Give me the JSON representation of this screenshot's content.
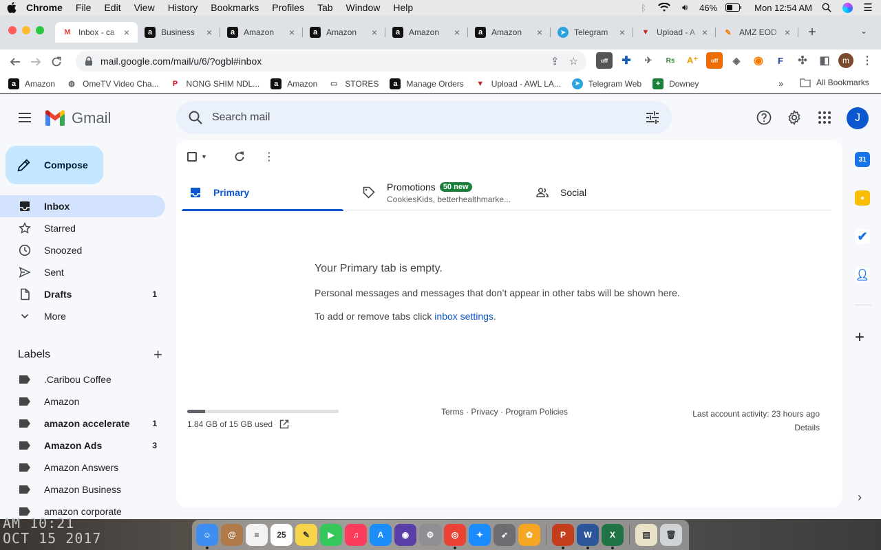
{
  "menubar": {
    "app": "Chrome",
    "items": [
      "File",
      "Edit",
      "View",
      "History",
      "Bookmarks",
      "Profiles",
      "Tab",
      "Window",
      "Help"
    ],
    "battery": "46%",
    "clock": "Mon 12:54 AM"
  },
  "tabs": [
    {
      "label": "Inbox - ca",
      "favicon": "gmail-icon",
      "color": "#ea4335"
    },
    {
      "label": "Business",
      "favicon": "amazon-icon",
      "color": "#111111"
    },
    {
      "label": "Amazon",
      "favicon": "amazon-icon",
      "color": "#111111"
    },
    {
      "label": "Amazon",
      "favicon": "amazon-icon",
      "color": "#111111"
    },
    {
      "label": "Amazon",
      "favicon": "amazon-icon",
      "color": "#111111"
    },
    {
      "label": "Amazon",
      "favicon": "amazon-icon",
      "color": "#111111"
    },
    {
      "label": "Telegram",
      "favicon": "telegram-icon",
      "color": "#2aa3df"
    },
    {
      "label": "Upload - A",
      "favicon": "upload-icon",
      "color": "#c62828"
    },
    {
      "label": "AMZ EOD",
      "favicon": "pencil-icon",
      "color": "#f57c00"
    }
  ],
  "omnibox": {
    "url": "mail.google.com/mail/u/6/?ogbl#inbox"
  },
  "bookmarks": [
    {
      "label": "Amazon",
      "icon": "amazon-icon",
      "color": "#111111",
      "glyph": "a"
    },
    {
      "label": "OmeTV Video Cha...",
      "icon": "globe-icon",
      "color": "#5f6368",
      "glyph": "◍"
    },
    {
      "label": "NONG SHIM NDL...",
      "icon": "pinterest-icon",
      "color": "#e60023",
      "glyph": "P"
    },
    {
      "label": "Amazon",
      "icon": "amazon-icon",
      "color": "#111111",
      "glyph": "a"
    },
    {
      "label": "STORES",
      "icon": "folder-icon",
      "color": "#5f6368",
      "glyph": "▭"
    },
    {
      "label": "Manage Orders",
      "icon": "amazon-icon",
      "color": "#111111",
      "glyph": "a"
    },
    {
      "label": "Upload - AWL LA...",
      "icon": "upload-icon",
      "color": "#c62828",
      "glyph": "▼"
    },
    {
      "label": "Telegram Web",
      "icon": "telegram-icon",
      "color": "#2aa3df",
      "glyph": "➤"
    },
    {
      "label": "Downey",
      "icon": "sheets-icon",
      "color": "#188038",
      "glyph": "+"
    }
  ],
  "all_bookmarks": "All Bookmarks",
  "gmail": {
    "logo_text": "Gmail",
    "search_placeholder": "Search mail",
    "avatar_letter": "J",
    "compose": "Compose",
    "nav": [
      {
        "label": "Inbox",
        "count": "",
        "icon": "inbox-icon",
        "active": true,
        "bold": true
      },
      {
        "label": "Starred",
        "count": "",
        "icon": "star-icon",
        "active": false,
        "bold": false
      },
      {
        "label": "Snoozed",
        "count": "",
        "icon": "clock-icon",
        "active": false,
        "bold": false
      },
      {
        "label": "Sent",
        "count": "",
        "icon": "send-icon",
        "active": false,
        "bold": false
      },
      {
        "label": "Drafts",
        "count": "1",
        "icon": "draft-icon",
        "active": false,
        "bold": true
      },
      {
        "label": "More",
        "count": "",
        "icon": "chevron-down-icon",
        "active": false,
        "bold": false
      }
    ],
    "labels_title": "Labels",
    "labels": [
      {
        "label": ".Caribou Coffee",
        "count": "",
        "bold": false
      },
      {
        "label": "Amazon",
        "count": "",
        "bold": false
      },
      {
        "label": "amazon accelerate",
        "count": "1",
        "bold": true
      },
      {
        "label": "Amazon Ads",
        "count": "3",
        "bold": true
      },
      {
        "label": "Amazon Answers",
        "count": "",
        "bold": false
      },
      {
        "label": "Amazon Business",
        "count": "",
        "bold": false
      },
      {
        "label": "amazon corporate",
        "count": "",
        "bold": false
      }
    ],
    "tabs": {
      "primary": "Primary",
      "promotions": "Promotions",
      "promotions_badge": "50 new",
      "promotions_sub": "CookiesKids, betterhealthmarke...",
      "social": "Social"
    },
    "empty": {
      "title": "Your Primary tab is empty.",
      "line1": "Personal messages and messages that don’t appear in other tabs will be shown here.",
      "line2_prefix": "To add or remove tabs click ",
      "line2_link": "inbox settings",
      "line2_suffix": "."
    },
    "storage": {
      "text": "1.84 GB of 15 GB used",
      "fraction": 0.12
    },
    "footer": {
      "links": "Terms · Privacy · Program Policies",
      "activity": "Last account activity: 23 hours ago",
      "details": "Details"
    }
  },
  "desktop_clock": {
    "line1": "AM 10:21",
    "line2": "OCT 15 2017"
  },
  "dock": [
    {
      "name": "finder",
      "color": "#3d8ef0",
      "glyph": "☺",
      "run": true
    },
    {
      "name": "contacts",
      "color": "#b07a4a",
      "glyph": "@",
      "run": false
    },
    {
      "name": "reminders",
      "color": "#f2f2f2",
      "glyph": "≡",
      "run": false
    },
    {
      "name": "calendar",
      "color": "#ffffff",
      "glyph": "25",
      "run": false
    },
    {
      "name": "notes",
      "color": "#f7d54a",
      "glyph": "✎",
      "run": false
    },
    {
      "name": "facetime",
      "color": "#34c759",
      "glyph": "▶",
      "run": false
    },
    {
      "name": "music",
      "color": "#fc3c5c",
      "glyph": "♫",
      "run": false
    },
    {
      "name": "app-store",
      "color": "#1c8ef9",
      "glyph": "A",
      "run": false
    },
    {
      "name": "siri",
      "color": "#5a3ea8",
      "glyph": "◉",
      "run": false
    },
    {
      "name": "system-preferences",
      "color": "#8e8e93",
      "glyph": "⚙",
      "run": false
    },
    {
      "name": "chrome",
      "color": "#ea4335",
      "glyph": "◎",
      "run": true
    },
    {
      "name": "safari",
      "color": "#1a8cff",
      "glyph": "✦",
      "run": false
    },
    {
      "name": "launchpad",
      "color": "#6d6d72",
      "glyph": "➶",
      "run": false
    },
    {
      "name": "photos",
      "color": "#f5a623",
      "glyph": "✿",
      "run": false
    },
    {
      "name": "powerpoint",
      "color": "#c43e1c",
      "glyph": "P",
      "run": true
    },
    {
      "name": "word",
      "color": "#2b579a",
      "glyph": "W",
      "run": true
    },
    {
      "name": "excel",
      "color": "#217346",
      "glyph": "X",
      "run": true
    },
    {
      "name": "preview",
      "color": "#e8e3c8",
      "glyph": "▤",
      "run": false
    },
    {
      "name": "trash",
      "color": "#cfd3d6",
      "glyph": "🗑",
      "run": false
    }
  ]
}
